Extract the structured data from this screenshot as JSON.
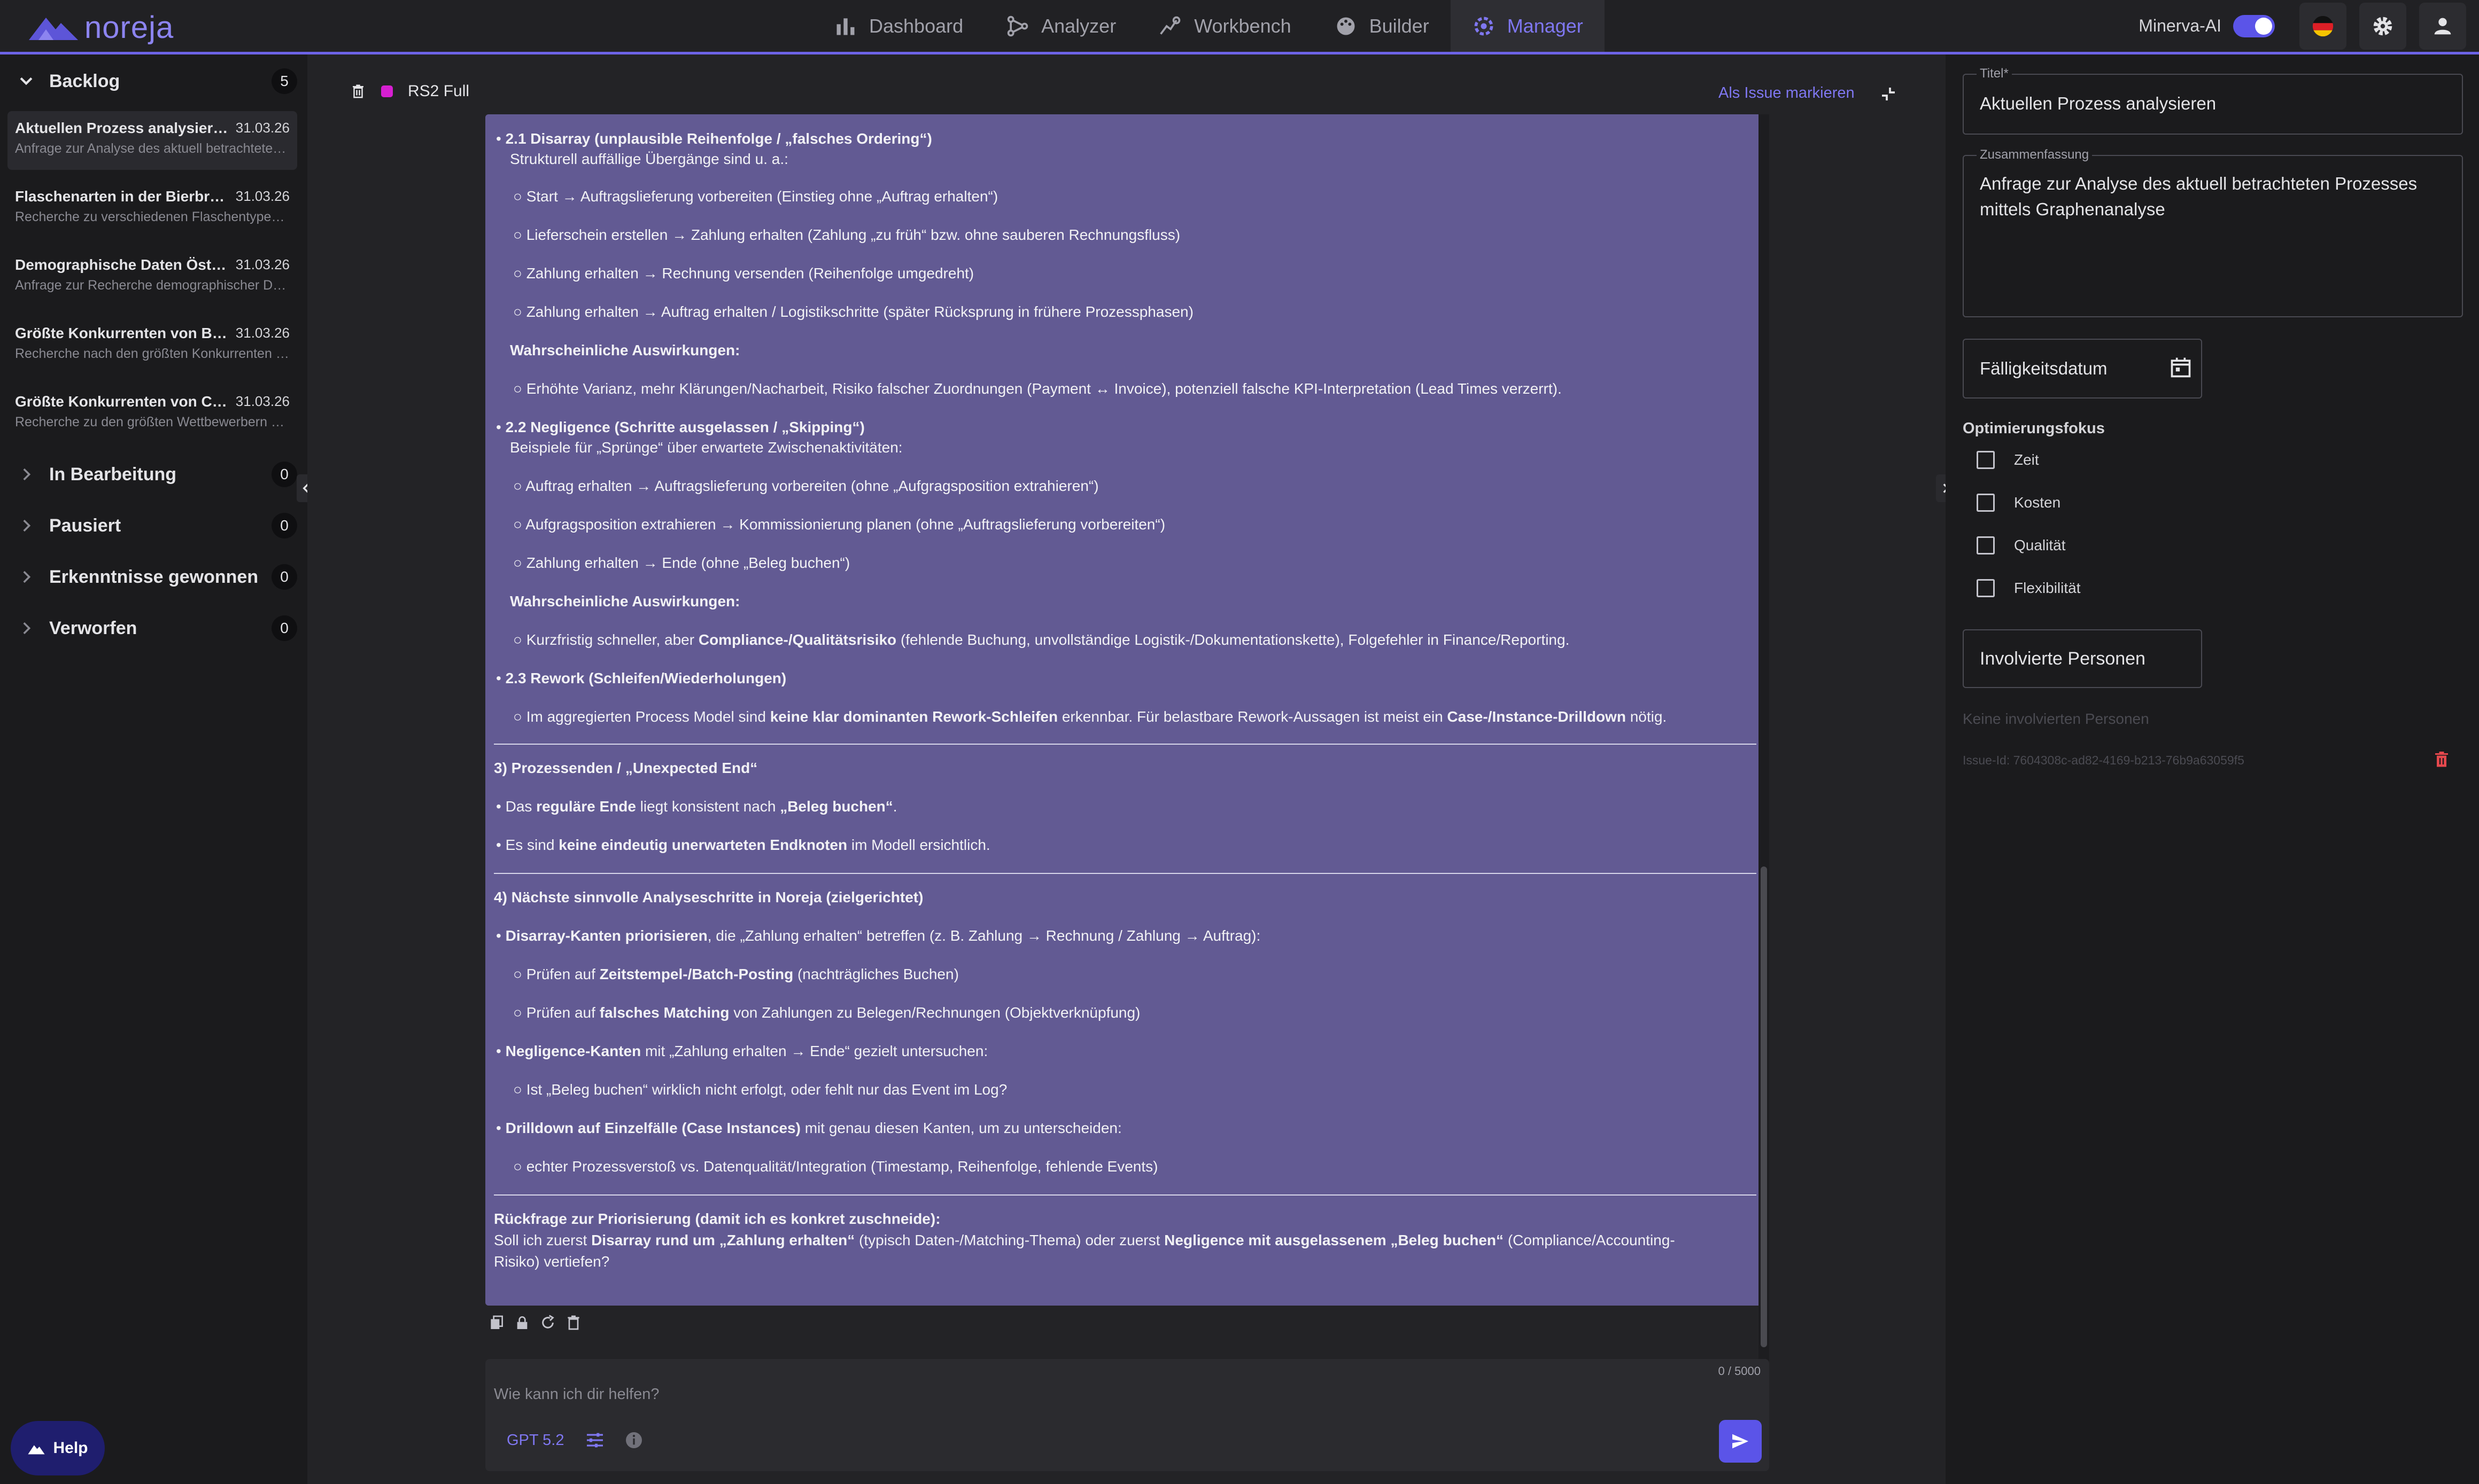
{
  "app": {
    "brand": "noreja"
  },
  "nav": {
    "items": [
      {
        "label": "Dashboard",
        "icon": "bar-chart-icon",
        "active": false
      },
      {
        "label": "Analyzer",
        "icon": "branch-icon",
        "active": false
      },
      {
        "label": "Workbench",
        "icon": "search-graph-icon",
        "active": false
      },
      {
        "label": "Builder",
        "icon": "palette-icon",
        "active": false
      },
      {
        "label": "Manager",
        "icon": "gear-hub-icon",
        "active": true
      }
    ]
  },
  "topbar": {
    "minerva_label": "Minerva-AI",
    "minerva_enabled": true,
    "language_icon": "german-flag-icon"
  },
  "sidebar": {
    "groups": [
      {
        "label": "Backlog",
        "count": "5",
        "expanded": true
      },
      {
        "label": "In Bearbeitung",
        "count": "0",
        "expanded": false
      },
      {
        "label": "Pausiert",
        "count": "0",
        "expanded": false
      },
      {
        "label": "Erkenntnisse gewonnen",
        "count": "0",
        "expanded": false
      },
      {
        "label": "Verworfen",
        "count": "0",
        "expanded": false
      }
    ],
    "items": [
      {
        "title": "Aktuellen Prozess analysieren",
        "date": "31.03.26",
        "subtitle": "Anfrage zur Analyse des aktuell betrachteten Prozesses mittels Graphenanalyse"
      },
      {
        "title": "Flaschenarten in der Bierbranche",
        "date": "31.03.26",
        "subtitle": "Recherche zu verschiedenen Flaschentypen in der Bierbranche"
      },
      {
        "title": "Demographische Daten Österreich",
        "date": "31.03.26",
        "subtitle": "Anfrage zur Recherche demographischer Daten"
      },
      {
        "title": "Größte Konkurrenten von Brauereien",
        "date": "31.03.26",
        "subtitle": "Recherche nach den größten Konkurrenten von Brauereien"
      },
      {
        "title": "Größte Konkurrenten von Certain",
        "date": "31.03.26",
        "subtitle": "Recherche zu den größten Wettbewerbern des Unternehmens"
      }
    ],
    "help_label": "Help"
  },
  "chat": {
    "title": "RS2 Full",
    "mark_issue_label": "Als Issue markieren",
    "message": {
      "s21_title": "2.1 Disarray (unplausible Reihenfolge / „falsches Ordering“)",
      "s21_intro": "Strukturell auffällige Übergänge sind u. a.:",
      "s21_b1": "Start → Auftragslieferung vorbereiten (Einstieg ohne „Auftrag erhalten“)",
      "s21_b2": "Lieferschein erstellen → Zahlung erhalten (Zahlung „zu früh“ bzw. ohne sauberen Rechnungsfluss)",
      "s21_b3": "Zahlung erhalten → Rechnung versenden (Reihenfolge umgedreht)",
      "s21_b4": "Zahlung erhalten → Auftrag erhalten / Logistikschritte (später Rücksprung in frühere Prozessphasen)",
      "effects_label": "Wahrscheinliche Auswirkungen:",
      "s21_effect": "Erhöhte Varianz, mehr Klärungen/Nacharbeit, Risiko falscher Zuordnungen (Payment ↔ Invoice), potenziell falsche KPI-Interpretation (Lead Times verzerrt).",
      "s22_title": "2.2 Negligence (Schritte ausgelassen / „Skipping“)",
      "s22_intro": "Beispiele für „Sprünge“ über erwartete Zwischenaktivitäten:",
      "s22_b1": "Auftrag erhalten → Auftragslieferung vorbereiten (ohne „Aufgragsposition extrahieren“)",
      "s22_b2": "Aufgragsposition extrahieren → Kommissionierung planen (ohne „Auftragslieferung vorbereiten“)",
      "s22_b3": "Zahlung erhalten → Ende (ohne „Beleg buchen“)",
      "s22_effect_a": "Kurzfristig schneller, aber ",
      "s22_effect_b": "Compliance-/Qualitätsrisiko",
      "s22_effect_c": " (fehlende Buchung, unvollständige Logistik-/Dokumentationskette), Folgefehler in Finance/Reporting.",
      "s23_title": "2.3 Rework (Schleifen/Wiederholungen)",
      "s23_a": "Im aggregierten Process Model sind ",
      "s23_b": "keine klar dominanten Rework-Schleifen",
      "s23_c": " erkennbar. Für belastbare Rework-Aussagen ist meist ein ",
      "s23_d": "Case-/Instance-Drilldown",
      "s23_e": " nötig.",
      "s3_title": "3) Prozessenden / „Unexpected End“",
      "s3_b1_a": "Das ",
      "s3_b1_b": "reguläre Ende",
      "s3_b1_c": " liegt konsistent nach ",
      "s3_b1_d": "„Beleg buchen“",
      "s3_b1_e": ".",
      "s3_b2_a": "Es sind ",
      "s3_b2_b": "keine eindeutig unerwarteten Endknoten",
      "s3_b2_c": " im Modell ersichtlich.",
      "s4_title": "4) Nächste sinnvolle Analyseschritte in Noreja (zielgerichtet)",
      "s4_b1_a": "Disarray-Kanten priorisieren",
      "s4_b1_b": ", die „Zahlung erhalten“ betreffen (z. B. Zahlung → Rechnung / Zahlung → Auftrag):",
      "s4_b1_s1_a": "Prüfen auf ",
      "s4_b1_s1_b": "Zeitstempel-/Batch-Posting",
      "s4_b1_s1_c": " (nachträgliches Buchen)",
      "s4_b1_s2_a": "Prüfen auf ",
      "s4_b1_s2_b": "falsches Matching",
      "s4_b1_s2_c": " von Zahlungen zu Belegen/Rechnungen (Objektverknüpfung)",
      "s4_b2_a": "Negligence-Kanten",
      "s4_b2_b": " mit „Zahlung erhalten → Ende“ gezielt untersuchen:",
      "s4_b2_s1": "Ist „Beleg buchen“ wirklich nicht erfolgt, oder fehlt nur das Event im Log?",
      "s4_b3_a": "Drilldown auf Einzelfälle (Case Instances)",
      "s4_b3_b": " mit genau diesen Kanten, um zu unterscheiden:",
      "s4_b3_s1": "echter Prozessverstoß vs. Datenqualität/Integration (Timestamp, Reihenfolge, fehlende Events)",
      "q_title": "Rückfrage zur Priorisierung (damit ich es konkret zuschneide):",
      "q_a": "Soll ich zuerst ",
      "q_b": "Disarray rund um „Zahlung erhalten“",
      "q_c": " (typisch Daten-/Matching-Thema) oder zuerst ",
      "q_d": "Negligence mit ausgelassenem „Beleg buchen“",
      "q_e": " (Compliance/Accounting-",
      "q_f": "Risiko) vertiefen?"
    },
    "composer": {
      "counter": "0 / 5000",
      "placeholder": "Wie kann ich dir helfen?",
      "model": "GPT 5.2"
    }
  },
  "details": {
    "title_label": "Titel*",
    "title_value": "Aktuellen Prozess analysieren",
    "summary_label": "Zusammenfassung",
    "summary_line1": "Anfrage zur Analyse des aktuell betrachteten Prozesses",
    "summary_line2": "mittels Graphenanalyse",
    "due_label": "Fälligkeitsdatum",
    "focus_label": "Optimierungsfokus",
    "focus_options": [
      {
        "label": "Zeit",
        "checked": false
      },
      {
        "label": "Kosten",
        "checked": false
      },
      {
        "label": "Qualität",
        "checked": false
      },
      {
        "label": "Flexibilität",
        "checked": false
      }
    ],
    "persons_button": "Involvierte Personen",
    "no_persons": "Keine involvierten Personen",
    "issue_id": "Issue-Id: 7604308c-ad82-4169-b213-76b9a63059f5"
  },
  "colors": {
    "accent": "#6d63e6",
    "bubble": "#625a93",
    "danger": "#e5484d",
    "tag": "#d61fd1"
  }
}
